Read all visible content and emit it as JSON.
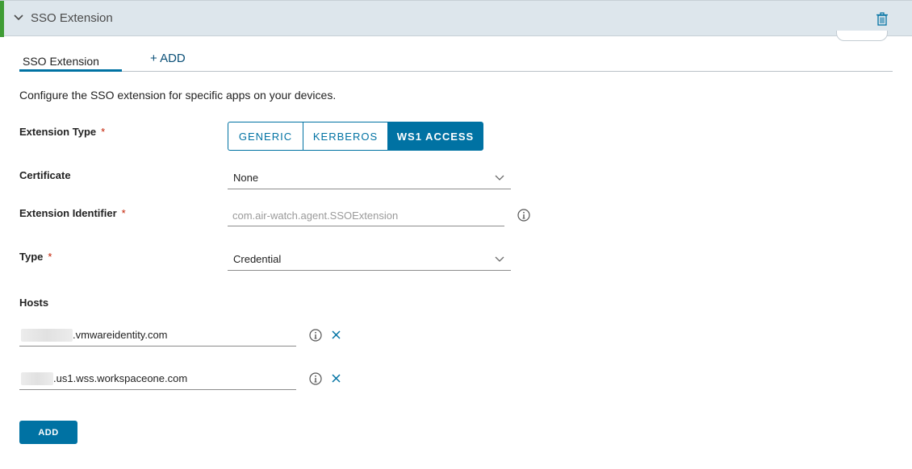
{
  "header": {
    "title": "SSO Extension",
    "collapse_icon": "chevron-down-icon",
    "delete_icon": "trash-icon"
  },
  "tabs": [
    {
      "label": "SSO Extension",
      "active": true
    },
    {
      "label": "+ ADD"
    }
  ],
  "description": "Configure the SSO extension for specific apps on your devices.",
  "form": {
    "extension_type": {
      "label": "Extension Type",
      "required_mark": "*",
      "options": [
        "GENERIC",
        "KERBEROS",
        "WS1 ACCESS"
      ],
      "selected": "WS1 ACCESS"
    },
    "certificate": {
      "label": "Certificate",
      "value": "None"
    },
    "extension_identifier": {
      "label": "Extension Identifier",
      "required_mark": "*",
      "placeholder": "com.air-watch.agent.SSOExtension",
      "value": ""
    },
    "type": {
      "label": "Type",
      "required_mark": "*",
      "value": "Credential"
    },
    "hosts": {
      "label": "Hosts",
      "items": [
        {
          "value": ".vmwareidentity.com"
        },
        {
          "value": ".us1.wss.workspaceone.com"
        }
      ]
    }
  },
  "add_button": "ADD",
  "colors": {
    "accent": "#0072a3",
    "header_bg": "#dde6ec",
    "status_green": "#3f9c35",
    "required": "#c21d00"
  }
}
